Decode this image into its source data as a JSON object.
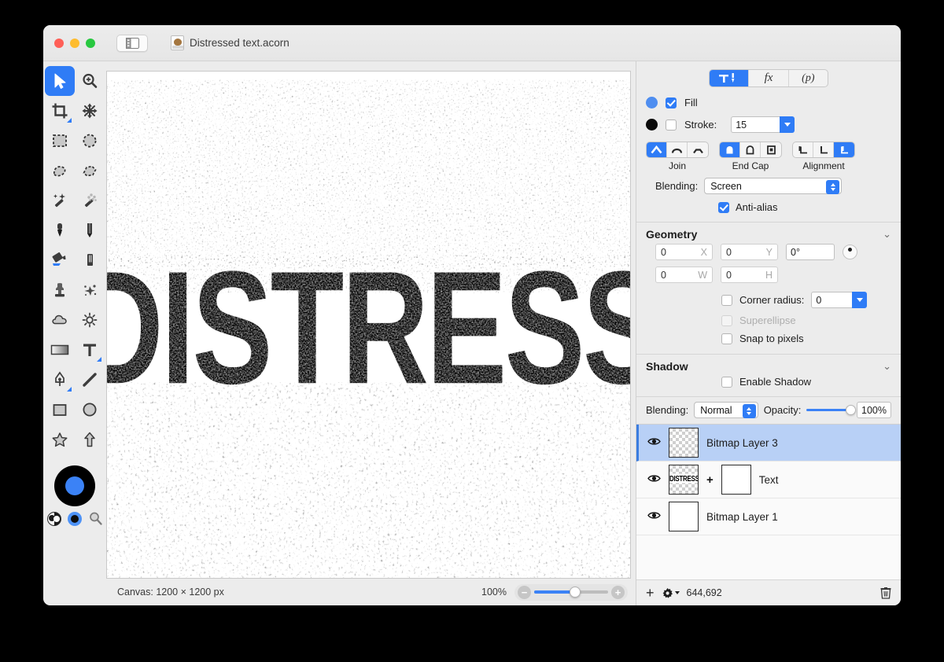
{
  "window": {
    "title": "Distressed text.acorn",
    "app_icon": "acorn-document-icon",
    "sidebar_toggle": "sidebar-toggle-icon"
  },
  "tools": [
    {
      "name": "move-tool",
      "label": "Move",
      "selected": true
    },
    {
      "name": "zoom-tool",
      "label": "Zoom",
      "selected": false
    },
    {
      "name": "crop-tool",
      "label": "Crop",
      "selected": false
    },
    {
      "name": "transform-tool",
      "label": "Transform",
      "selected": false
    },
    {
      "name": "rectangular-selection-tool",
      "label": "Rectangular Selection",
      "selected": false
    },
    {
      "name": "elliptical-selection-tool",
      "label": "Elliptical Selection",
      "selected": false
    },
    {
      "name": "lasso-tool",
      "label": "Lasso",
      "selected": false
    },
    {
      "name": "polygon-lasso-tool",
      "label": "Polygon Lasso",
      "selected": false
    },
    {
      "name": "magic-wand-tool",
      "label": "Magic Wand",
      "selected": false
    },
    {
      "name": "instant-alpha-tool",
      "label": "Instant Alpha",
      "selected": false
    },
    {
      "name": "brush-tool",
      "label": "Brush",
      "selected": false
    },
    {
      "name": "pencil-tool",
      "label": "Pencil",
      "selected": false
    },
    {
      "name": "paint-bucket-tool",
      "label": "Paint Bucket",
      "selected": false
    },
    {
      "name": "eraser-tool",
      "label": "Eraser",
      "selected": false
    },
    {
      "name": "clone-stamp-tool",
      "label": "Clone Stamp",
      "selected": false
    },
    {
      "name": "smudge-tool",
      "label": "Smudge",
      "selected": false
    },
    {
      "name": "blur-tool",
      "label": "Blur",
      "selected": false
    },
    {
      "name": "sharpen-tool",
      "label": "Sharpen",
      "selected": false
    },
    {
      "name": "gradient-tool",
      "label": "Gradient",
      "selected": false
    },
    {
      "name": "text-tool",
      "label": "Text",
      "selected": false
    },
    {
      "name": "pen-tool",
      "label": "Pen",
      "selected": false
    },
    {
      "name": "line-tool",
      "label": "Line",
      "selected": false
    },
    {
      "name": "rectangle-tool",
      "label": "Rectangle",
      "selected": false
    },
    {
      "name": "ellipse-tool",
      "label": "Ellipse",
      "selected": false
    },
    {
      "name": "star-tool",
      "label": "Star",
      "selected": false
    },
    {
      "name": "arrow-tool",
      "label": "Arrow",
      "selected": false
    }
  ],
  "colors": {
    "foreground": "#3b82f6",
    "background": "#000000",
    "accent": "#2f7cf6",
    "selection_blue": "#b8d0f6"
  },
  "canvas": {
    "artwork_text": "DISTRESS",
    "size_label": "Canvas: 1200 × 1200 px",
    "zoom_label": "100%",
    "zoom_minus": "−",
    "zoom_plus": "+",
    "zoom_value": 55
  },
  "inspector": {
    "tabs": [
      {
        "name": "tab-tool-options",
        "label": "",
        "icon": "hammer-pen-icon",
        "active": true
      },
      {
        "name": "tab-filters",
        "label": "fx",
        "active": false
      },
      {
        "name": "tab-palette",
        "label": "(p)",
        "active": false
      }
    ],
    "fill": {
      "label": "Fill",
      "checked": true,
      "color": "#4f8ef0"
    },
    "stroke": {
      "label": "Stroke:",
      "checked": false,
      "color": "#0b0b0b",
      "width": "15"
    },
    "join": {
      "label": "Join",
      "options": [
        "miter",
        "round",
        "bevel"
      ],
      "selected": 0
    },
    "end_cap": {
      "label": "End Cap",
      "options": [
        "butt",
        "round",
        "square"
      ],
      "selected": 0
    },
    "alignment": {
      "label": "Alignment",
      "options": [
        "inside",
        "center",
        "outside"
      ],
      "selected": 2
    },
    "blending": {
      "label": "Blending:",
      "value": "Screen"
    },
    "anti_alias": {
      "label": "Anti-alias",
      "checked": true
    },
    "geometry": {
      "title": "Geometry",
      "x": {
        "value": "0",
        "unit": "X"
      },
      "y": {
        "value": "0",
        "unit": "Y"
      },
      "rotation": "0°",
      "w": {
        "value": "0",
        "unit": "W"
      },
      "h": {
        "value": "0",
        "unit": "H"
      },
      "corner_radius": {
        "label": "Corner radius:",
        "checked": false,
        "value": "0"
      },
      "superellipse": {
        "label": "Superellipse",
        "checked": false,
        "disabled": true
      },
      "snap_to_pixels": {
        "label": "Snap to pixels",
        "checked": false
      }
    },
    "shadow": {
      "title": "Shadow",
      "enable": {
        "label": "Enable Shadow",
        "checked": false
      }
    }
  },
  "layer_bar": {
    "blending_label": "Blending:",
    "blending_value": "Normal",
    "opacity_label": "Opacity:",
    "opacity_value": "100%",
    "opacity_percent": 100
  },
  "layers": [
    {
      "name": "Bitmap Layer 3",
      "selected": true,
      "visible": true,
      "thumb": "transparent",
      "has_mask": false
    },
    {
      "name": "Text",
      "selected": false,
      "visible": true,
      "thumb": "text",
      "thumb_text": "DISTRESS",
      "has_mask": true,
      "mask_sep": "+"
    },
    {
      "name": "Bitmap Layer 1",
      "selected": false,
      "visible": true,
      "thumb": "white",
      "has_mask": false
    }
  ],
  "layer_footer": {
    "add": "+",
    "gear": "gear-icon",
    "coordinates": "644,692",
    "trash": "trash-icon"
  }
}
